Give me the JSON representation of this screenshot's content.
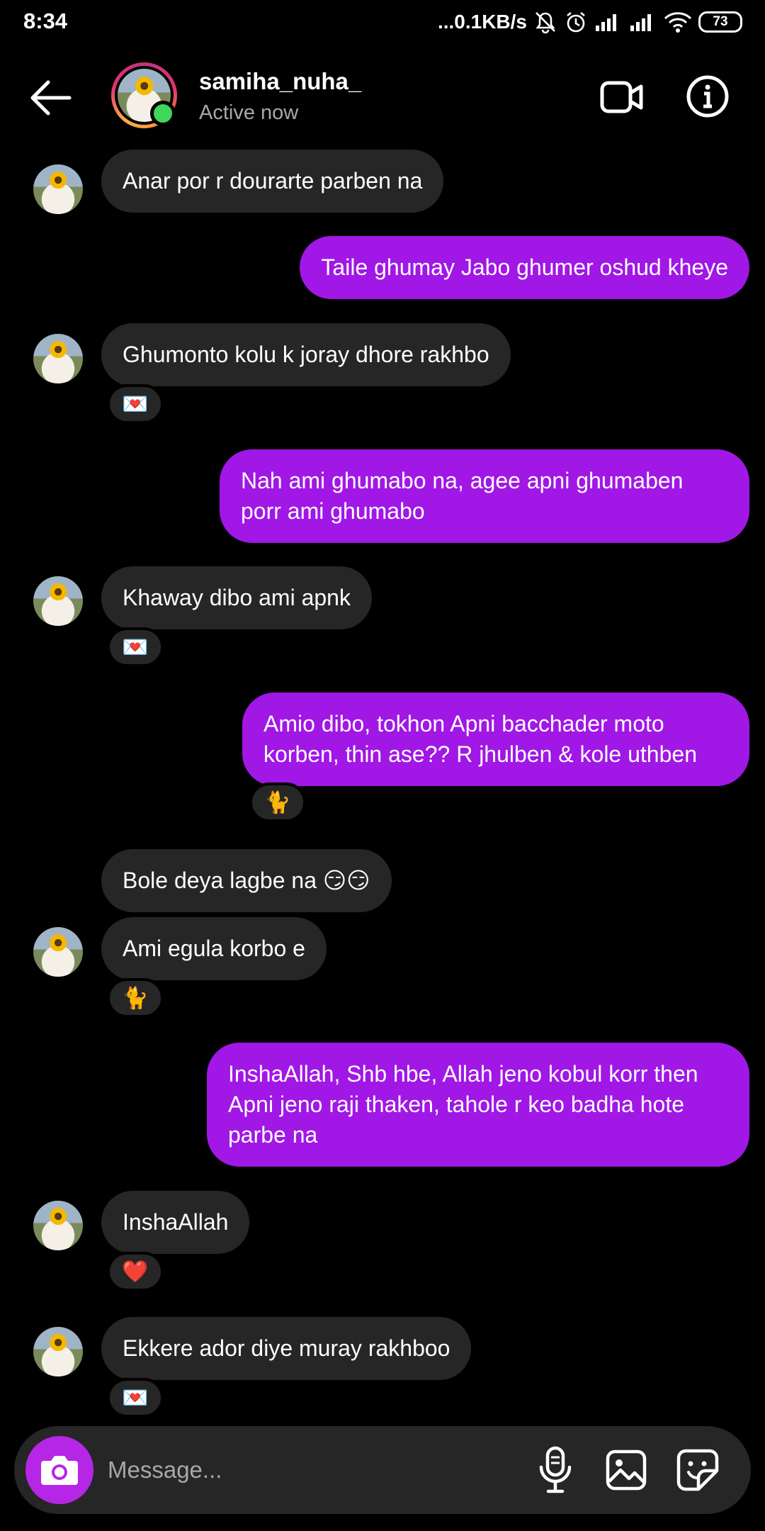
{
  "status_bar": {
    "time": "8:34",
    "net_speed": "...0.1KB/s",
    "battery": "73"
  },
  "header": {
    "username": "samiha_nuha_",
    "status": "Active now"
  },
  "messages": [
    {
      "dir": "in",
      "text": "Anar por r dourarte parben na"
    },
    {
      "dir": "out",
      "text": "Taile ghumay Jabo ghumer oshud kheye"
    },
    {
      "dir": "in",
      "text": "Ghumonto kolu k joray dhore rakhbo",
      "reaction": "💌"
    },
    {
      "dir": "out",
      "text": "Nah ami ghumabo na, agee apni ghumaben porr ami ghumabo"
    },
    {
      "dir": "in",
      "text": "Khaway dibo ami apnk",
      "reaction": "💌"
    },
    {
      "dir": "out",
      "text": "Amio dibo, tokhon Apni bacchader moto korben, thin ase?? R jhulben & kole uthben",
      "reaction": "🐈"
    },
    {
      "dir": "in",
      "text": "Bole deya lagbe na 😏😏"
    },
    {
      "dir": "in",
      "text": "Ami egula korbo e",
      "reaction": "🐈"
    },
    {
      "dir": "out",
      "text": "InshaAllah, Shb hbe, Allah jeno kobul korr then Apni jeno raji thaken, tahole r keo badha hote parbe na"
    },
    {
      "dir": "in",
      "text": "InshaAllah",
      "reaction": "❤️"
    },
    {
      "dir": "in",
      "text": "Ekkere ador diye muray rakhboo",
      "reaction": "💌"
    }
  ],
  "composer": {
    "placeholder": "Message..."
  },
  "icons": [
    "back-arrow-icon",
    "video-call-icon",
    "info-icon",
    "camera-icon",
    "microphone-icon",
    "gallery-icon",
    "sticker-icon"
  ],
  "colors": {
    "outgoing_bubble": "#a117e6",
    "incoming_bubble": "#262626",
    "online": "#3fd65a",
    "camera_button": "#b626e6"
  }
}
